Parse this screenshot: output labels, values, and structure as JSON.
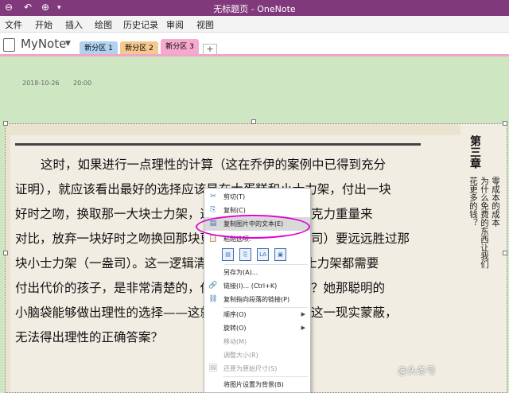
{
  "titlebar": {
    "title": "无标题页 - OneNote",
    "back": "⊖",
    "undo": "↶",
    "pin": "⊕",
    "more": "▾"
  },
  "menu": [
    "文件",
    "开始",
    "插入",
    "绘图",
    "历史记录",
    "审阅",
    "视图"
  ],
  "notebook": {
    "name": "MyNote",
    "caret": "▼"
  },
  "tabs": [
    {
      "label": "新分区 1",
      "color": "#b0d1ef"
    },
    {
      "label": "新分区 2",
      "color": "#f4c88f"
    },
    {
      "label": "新分区 3",
      "color": "#f4a9cd"
    }
  ],
  "add_tab": "+",
  "page": {
    "date": "2018-10-26",
    "time": "20:00"
  },
  "document": {
    "lines": [
      "这时，如果进行一点理性的计算（这在乔伊的案例中已得到充分",
      "证明），就应该看出最好的选择应该是在大蛋糕和小士力架，付出一块",
      "好时之吻，换取那一大块士力架，这是将非常便宜的巧克力重量来",
      "对比，放弃一块好时之吻换回那块更大的士力架（一盎司）要远远胜过那",
      "块小士力架（一盎司）。这一逻辑清晰，一盎司的大小士力架都需要",
      "付出代价的孩子，是非常清楚的，但是为什么会这样呢？她那聪明的",
      "小脑袋能够做出理性的选择——这就是毫不犹豫地免费这一现实蒙蔽，",
      "无法得出理性的正确答案？"
    ],
    "chapter": "第三章",
    "side_lines": [
      "零成本的成本",
      "为什么免费的东西让我们",
      "花更多的钱？"
    ]
  },
  "context_menu": {
    "items": [
      {
        "icon": "✂",
        "label": "剪切(T)",
        "disabled": false
      },
      {
        "icon": "⎘",
        "label": "复制(C)",
        "disabled": false
      },
      {
        "icon": "▤",
        "label": "复制图片中的文本(E)",
        "disabled": false,
        "highlighted": true
      },
      {
        "icon": "📋",
        "label": "粘贴选项:",
        "disabled": false
      },
      {
        "icon": "",
        "label": "另存为(A)...",
        "disabled": false
      },
      {
        "icon": "🔗",
        "label": "链接(I)...  (Ctrl+K)",
        "disabled": false
      },
      {
        "icon": "⛓",
        "label": "复制指向段落的链接(P)",
        "disabled": false
      },
      {
        "icon": "",
        "label": "顺序(O)",
        "disabled": false,
        "submenu": true
      },
      {
        "icon": "",
        "label": "旋转(O)",
        "disabled": false,
        "submenu": true
      },
      {
        "icon": "",
        "label": "移动(M)",
        "disabled": true
      },
      {
        "icon": "",
        "label": "调整大小(R)",
        "disabled": true
      },
      {
        "icon": "🖼",
        "label": "还原为原始尺寸(S)",
        "disabled": true
      },
      {
        "icon": "",
        "label": "将图片设置为背景(B)",
        "disabled": false
      }
    ],
    "paste_icons": [
      "▤",
      "⎘",
      "LA",
      "▣"
    ]
  },
  "watermark": "@头条号",
  "colors": {
    "accent": "#80397b",
    "highlight_oval": "#e000d0"
  }
}
